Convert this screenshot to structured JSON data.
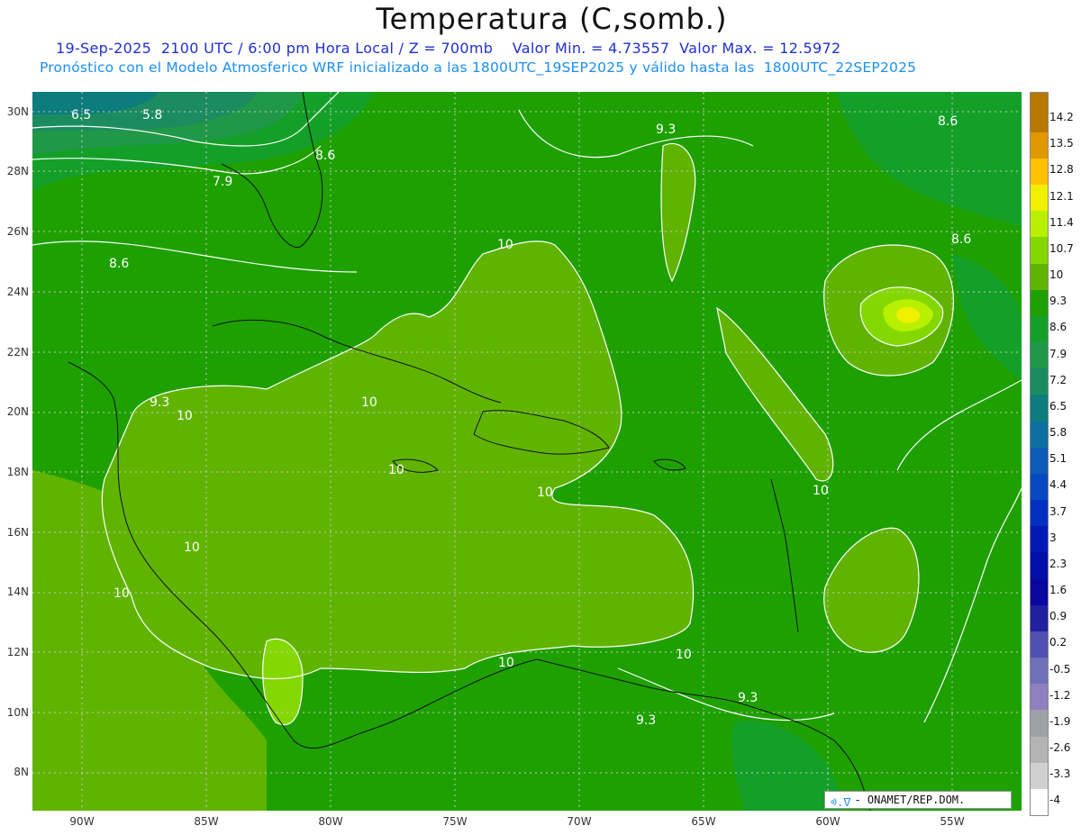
{
  "header": {
    "title": "Temperatura (C,somb.)",
    "line1": "19-Sep-2025  2100 UTC / 6:00 pm Hora Local / Z = 700mb    Valor Min. = 4.73557  Valor Max. = 12.5972",
    "line2": "Pronóstico con el Modelo Atmosferico WRF inicializado a las 1800UTC_19SEP2025 y válido hasta las  1800UTC_22SEP2025"
  },
  "axes": {
    "lat_labels": [
      "30N",
      "28N",
      "26N",
      "24N",
      "22N",
      "20N",
      "18N",
      "16N",
      "14N",
      "12N",
      "10N",
      "8N"
    ],
    "lon_labels": [
      "90W",
      "85W",
      "80W",
      "75W",
      "70W",
      "65W",
      "60W",
      "55W"
    ]
  },
  "colorbar": {
    "labels": [
      "14.2",
      "13.5",
      "12.8",
      "12.1",
      "11.4",
      "10.7",
      "10",
      "9.3",
      "8.6",
      "7.9",
      "7.2",
      "6.5",
      "5.8",
      "5.1",
      "4.4",
      "3.7",
      "3",
      "2.3",
      "1.6",
      "0.9",
      "0.2",
      "-0.5",
      "-1.2",
      "-1.9",
      "-2.6",
      "-3.3",
      "-4"
    ],
    "colors": [
      "#b87800",
      "#e09800",
      "#ffc000",
      "#f0f000",
      "#b8f000",
      "#84d800",
      "#60b400",
      "#1ea000",
      "#14a028",
      "#209848",
      "#1c8c60",
      "#0c7c7c",
      "#0f6ea0",
      "#0c5cb8",
      "#0848c0",
      "#0030c0",
      "#0018b4",
      "#0010a8",
      "#0808a0",
      "#2020a0",
      "#5050b0",
      "#7070b8",
      "#9080c0",
      "#a0a0a8",
      "#b4b4b4",
      "#d0d0d0",
      "#ffffff"
    ]
  },
  "contour_labels": [
    "6.5",
    "5.8",
    "7.9",
    "8.6",
    "8.6",
    "9.3",
    "8.6",
    "8.6",
    "10",
    "9.3",
    "10",
    "10",
    "10",
    "10",
    "10",
    "10",
    "10",
    "10",
    "10",
    "9.3",
    "9.3"
  ],
  "credit": {
    "logo": "ᢀ.ᐁ",
    "text": "- ONAMET/REP.DOM."
  }
}
